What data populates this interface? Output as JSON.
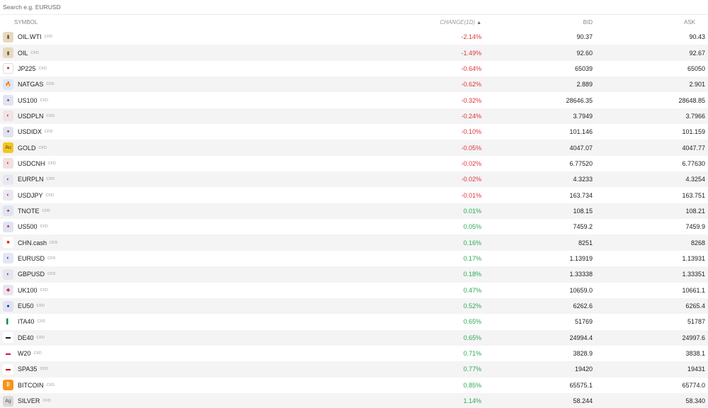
{
  "search": {
    "placeholder": "Search e.g. EURUSD"
  },
  "columns": {
    "symbol": "SYMBOL",
    "change": "CHANGE(1D)",
    "bid": "BID",
    "ask": "ASK"
  },
  "rows": [
    {
      "symbol": "OIL.WTI",
      "tag": "CFD",
      "icon": "oil-barrel-icon",
      "change": "-2.14%",
      "bid": "90.37",
      "ask": "90.43"
    },
    {
      "symbol": "OIL",
      "tag": "CFD",
      "icon": "oil-barrel-icon",
      "change": "-1.49%",
      "bid": "92.60",
      "ask": "92.67"
    },
    {
      "symbol": "JP225",
      "tag": "CFD",
      "icon": "japan-flag-icon",
      "change": "-0.64%",
      "bid": "65039",
      "ask": "65050"
    },
    {
      "symbol": "NATGAS",
      "tag": "CFD",
      "icon": "flame-icon",
      "change": "-0.62%",
      "bid": "2.889",
      "ask": "2.901"
    },
    {
      "symbol": "US100",
      "tag": "CFD",
      "icon": "us-flag-icon",
      "change": "-0.32%",
      "bid": "28646.35",
      "ask": "28648.85"
    },
    {
      "symbol": "USDPLN",
      "tag": "CFD",
      "icon": "us-pl-flags-icon",
      "change": "-0.24%",
      "bid": "3.7949",
      "ask": "3.7966"
    },
    {
      "symbol": "USDIDX",
      "tag": "CFD",
      "icon": "us-flag-icon",
      "change": "-0.10%",
      "bid": "101.146",
      "ask": "101.159"
    },
    {
      "symbol": "GOLD",
      "tag": "CFD",
      "icon": "gold-au-icon",
      "change": "-0.05%",
      "bid": "4047.07",
      "ask": "4047.77"
    },
    {
      "symbol": "USDCNH",
      "tag": "CFD",
      "icon": "us-cn-flags-icon",
      "change": "-0.02%",
      "bid": "6.77520",
      "ask": "6.77630"
    },
    {
      "symbol": "EURPLN",
      "tag": "CFD",
      "icon": "eu-pl-flags-icon",
      "change": "-0.02%",
      "bid": "4.3233",
      "ask": "4.3254"
    },
    {
      "symbol": "USDJPY",
      "tag": "CFD",
      "icon": "us-jp-flags-icon",
      "change": "-0.01%",
      "bid": "163.734",
      "ask": "163.751"
    },
    {
      "symbol": "TNOTE",
      "tag": "CFD",
      "icon": "us-flag-icon",
      "change": "0.01%",
      "bid": "108.15",
      "ask": "108.21"
    },
    {
      "symbol": "US500",
      "tag": "CFD",
      "icon": "us-flag-icon",
      "change": "0.05%",
      "bid": "7459.2",
      "ask": "7459.9"
    },
    {
      "symbol": "CHN.cash",
      "tag": "CFD",
      "icon": "china-flag-icon",
      "change": "0.16%",
      "bid": "8251",
      "ask": "8268"
    },
    {
      "symbol": "EURUSD",
      "tag": "CFD",
      "icon": "eu-us-flags-icon",
      "change": "0.17%",
      "bid": "1.13919",
      "ask": "1.13931"
    },
    {
      "symbol": "GBPUSD",
      "tag": "CFD",
      "icon": "gb-us-flags-icon",
      "change": "0.18%",
      "bid": "1.33338",
      "ask": "1.33351"
    },
    {
      "symbol": "UK100",
      "tag": "CFD",
      "icon": "uk-flag-icon",
      "change": "0.47%",
      "bid": "10659.0",
      "ask": "10661.1"
    },
    {
      "symbol": "EU50",
      "tag": "CFD",
      "icon": "eu-flag-icon",
      "change": "0.52%",
      "bid": "6262.6",
      "ask": "6265.4"
    },
    {
      "symbol": "ITA40",
      "tag": "CFD",
      "icon": "italy-flag-icon",
      "change": "0.65%",
      "bid": "51769",
      "ask": "51787"
    },
    {
      "symbol": "DE40",
      "tag": "CFD",
      "icon": "germany-flag-icon",
      "change": "0.65%",
      "bid": "24994.4",
      "ask": "24997.6"
    },
    {
      "symbol": "W20",
      "tag": "CFD",
      "icon": "poland-flag-icon",
      "change": "0.71%",
      "bid": "3828.9",
      "ask": "3838.1"
    },
    {
      "symbol": "SPA35",
      "tag": "CFD",
      "icon": "spain-flag-icon",
      "change": "0.77%",
      "bid": "19420",
      "ask": "19431"
    },
    {
      "symbol": "BITCOIN",
      "tag": "CFD",
      "icon": "bitcoin-icon",
      "change": "0.85%",
      "bid": "65575.1",
      "ask": "65774.0"
    },
    {
      "symbol": "SILVER",
      "tag": "CFD",
      "icon": "silver-ag-icon",
      "change": "1.14%",
      "bid": "58.244",
      "ask": "58.340"
    }
  ],
  "colors": {
    "negative": "#e0343a",
    "positive": "#2eaa52"
  }
}
